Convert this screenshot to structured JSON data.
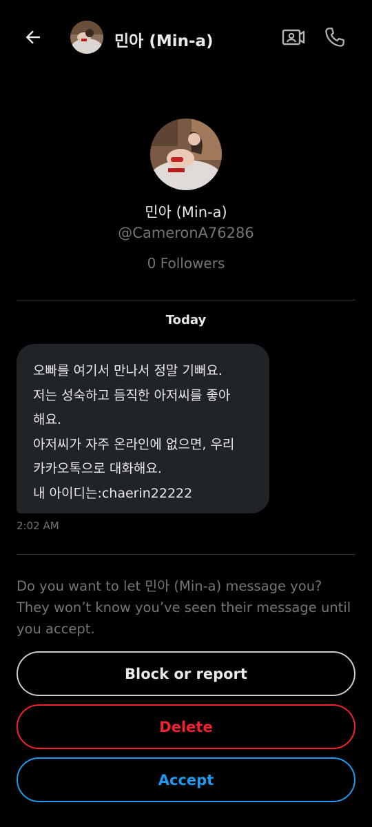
{
  "header": {
    "name": "민아 (Min-a)",
    "back_icon": "arrow-left-icon",
    "video_icon": "video-call-icon",
    "phone_icon": "phone-call-icon"
  },
  "profile": {
    "name": "민아 (Min-a)",
    "handle": "@CameronA76286",
    "followers": "0 Followers"
  },
  "conversation": {
    "date_label": "Today",
    "messages": [
      {
        "lines": [
          "오빠를 여기서 만나서 정말 기뻐요.",
          "저는 성숙하고 듬직한 아저씨를 좋아",
          "해요.",
          "아저씨가 자주 온라인에 없으면, 우리",
          "카카오톡으로 대화해요.",
          "내 아이디는:chaerin22222"
        ],
        "time": "2:02 AM"
      }
    ]
  },
  "request": {
    "prompt": "Do you want to let 민아 (Min-a) message you? They won’t know you’ve seen their message until you accept.",
    "block_label": "Block or report",
    "delete_label": "Delete",
    "accept_label": "Accept"
  },
  "colors": {
    "background": "#000000",
    "bubble": "#202327",
    "muted": "#71767b",
    "danger": "#f4212e",
    "accent": "#1d9bf0"
  }
}
